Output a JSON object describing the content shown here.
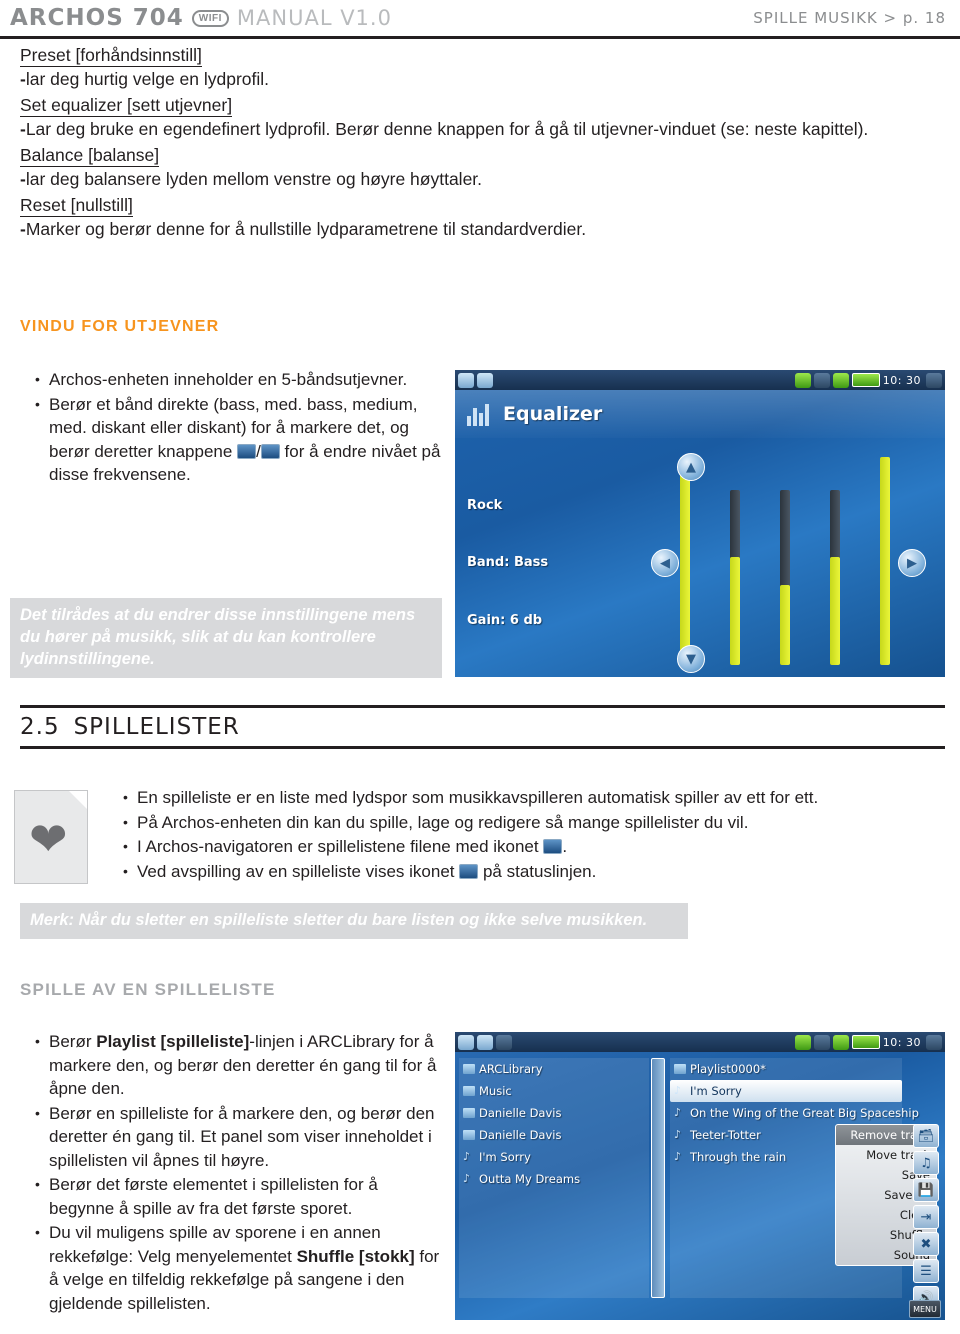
{
  "header": {
    "brand": "ARCHOS 704",
    "wifi": "WIFI",
    "manual": "MANUAL V1.0",
    "right": "SPILLE MUSIKK > p. 18"
  },
  "settings": [
    {
      "term": "Preset [forhåndsinnstill]",
      "desc": "lar deg hurtig velge en lydprofil."
    },
    {
      "term": "Set equalizer [sett utjevner]",
      "desc": "Lar deg bruke en egendefinert lydprofil. Berør denne knappen for å gå til utjevner-vinduet (se: neste kapittel)."
    },
    {
      "term": "Balance [balanse]",
      "desc": "lar deg balansere lyden mellom venstre og høyre høyttaler."
    },
    {
      "term": "Reset [nullstill]",
      "desc": "Marker og berør denne for å nullstille lydparametrene til standardverdier."
    }
  ],
  "eq_section": {
    "heading": "VINDU FOR UTJEVNER",
    "bullets": [
      "Archos-enheten inneholder en 5-båndsutjevner.",
      "Berør et bånd direkte (bass, med. bass, medium, med. diskant eller diskant) for å markere det, og berør deretter knappene  /  for å endre nivået på disse frekvensene."
    ],
    "note": "Det tilrådes at du endrer disse innstillingene mens du hører på musikk, slik at du kan kontrollere lydinnstillingene."
  },
  "eq_device": {
    "time": "10: 30",
    "title": "Equalizer",
    "preset": "Rock",
    "band": "Band: Bass",
    "gain": "Gain: 6 db",
    "up_arrow": "▲",
    "down_arrow": "▼",
    "left_arrow": "◀",
    "right_arrow": "▶"
  },
  "chapter": {
    "number": "2.5",
    "title": "SPILLELISTER",
    "bullets": [
      "En spilleliste er en liste med lydspor som musikkavspilleren automatisk spiller av ett for ett.",
      "På Archos-enheten din kan du spille, lage og redigere så mange spillelister du vil.",
      "I Archos-navigatoren er spillelistene filene med ikonet  .",
      "Ved avspilling av en spilleliste vises ikonet  på statuslinjen."
    ],
    "note": "Merk: Når du sletter en spilleliste sletter du bare listen og ikke selve musikken."
  },
  "play_section": {
    "heading": "SPILLE AV EN SPILLELISTE",
    "bullets": [
      "Berør Playlist [spilleliste]-linjen i ARCLibrary for å markere den, og berør den deretter én gang til for å åpne den.",
      "Berør en spilleliste for å markere den, og berør den deretter én gang til. Et panel som viser inneholdet i spillelisten vil åpnes til høyre.",
      "Berør det første elementet i spillelisten for å begynne å spille av fra det første sporet.",
      "Du vil muligens spille av sporene i en annen rekkefølge: Velg menyelementet Shuffle [stokk] for å velge en tilfeldig rekkefølge på sangene i den gjeldende spillelisten."
    ],
    "bold_terms": [
      "Playlist [spilleliste]",
      "Shuffle [stokk]"
    ]
  },
  "pl_device": {
    "time": "10: 30",
    "left_list": [
      "ARCLibrary",
      "Music",
      "Danielle Davis",
      "Danielle Davis",
      "I'm Sorry",
      "Outta My Dreams"
    ],
    "right_header": "Playlist0000*",
    "right_list": [
      "I'm Sorry",
      "On the Wing of the Great Big Spaceship",
      "Teeter-Totter",
      "Through the rain"
    ],
    "menu": [
      "Remove track",
      "Move track",
      "Save",
      "Save As",
      "Clear",
      "Shuffle",
      "Sound"
    ],
    "menu_label": "MENU"
  },
  "colors": {
    "orange": "#f7941e",
    "grey_head": "#a7a9ac",
    "note_bg": "#d8d9db",
    "device_blue": "#1a5fa8",
    "slider_yellow": "#d8e81f",
    "slider_dark": "#2f3a44"
  }
}
